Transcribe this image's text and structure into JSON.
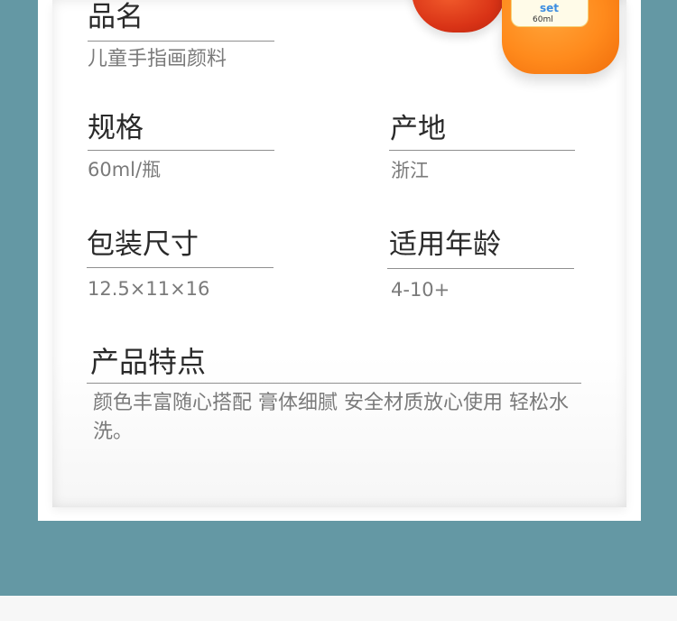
{
  "product_image": {
    "label_text": "set",
    "volume_text": "60ml"
  },
  "specs": {
    "name": {
      "heading": "品名",
      "value": "儿童手指画颜料"
    },
    "size": {
      "heading": "规格",
      "value": "60ml/瓶"
    },
    "origin": {
      "heading": "产地",
      "value": "浙江"
    },
    "package": {
      "heading": "包装尺寸",
      "value": "12.5×11×16"
    },
    "age": {
      "heading": "适用年龄",
      "value": "4-10+"
    }
  },
  "features": {
    "heading": "产品特点",
    "text": "颜色丰富随心搭配 膏体细腻 安全材质放心使用 轻松水洗。"
  },
  "colors": {
    "teal_background": "#6498a4",
    "heading_text": "#2a2a2a",
    "value_text": "#7a7a7a",
    "divider": "#8f8f8f"
  }
}
